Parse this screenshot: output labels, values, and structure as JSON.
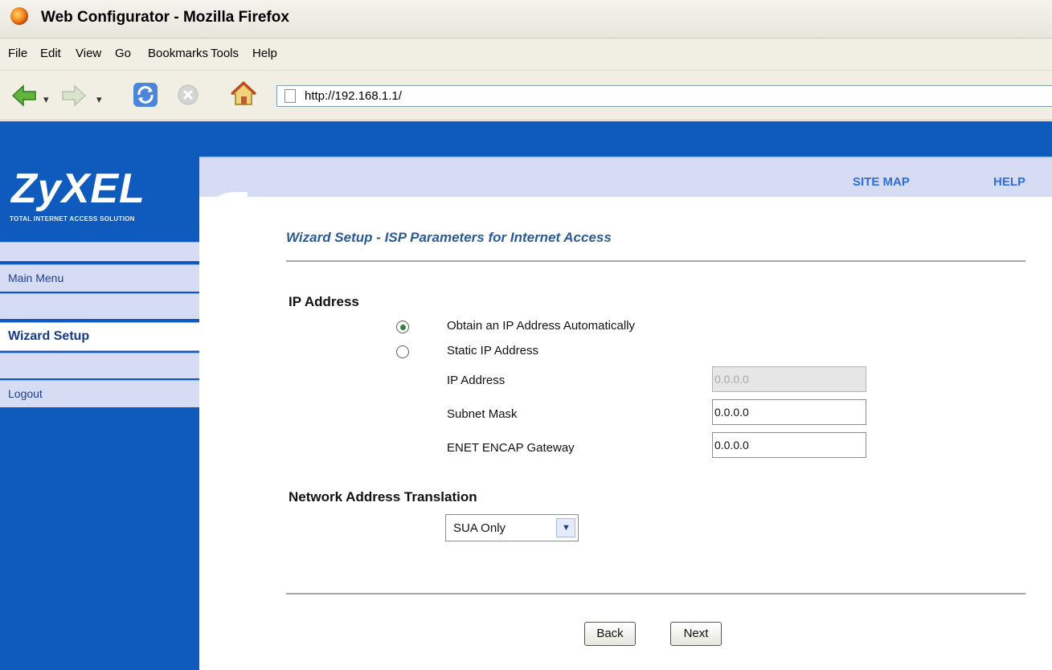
{
  "window": {
    "title": "Web Configurator - Mozilla Firefox"
  },
  "menu": [
    "File",
    "Edit",
    "View",
    "Go",
    "Bookmarks",
    "Tools",
    "Help"
  ],
  "toolbar": {
    "url": "http://192.168.1.1/",
    "dropdown_glyph": "▾"
  },
  "header": {
    "site_map": "SITE MAP",
    "help": "HELP"
  },
  "brand": {
    "logo": "ZyXEL",
    "tagline": "TOTAL INTERNET ACCESS SOLUTION"
  },
  "sidebar": {
    "items": [
      {
        "label": "Main Menu"
      },
      {
        "label": "Wizard Setup"
      },
      {
        "label": "Logout"
      }
    ]
  },
  "main": {
    "title": "Wizard Setup - ISP Parameters for Internet Access",
    "ip_section": {
      "heading": "IP Address",
      "auto_label": "Obtain an IP Address Automatically",
      "static_label": "Static IP Address",
      "selected": "auto",
      "fields": [
        {
          "label": "IP Address",
          "value": "0.0.0.0",
          "disabled": true
        },
        {
          "label": "Subnet Mask",
          "value": "0.0.0.0",
          "disabled": false
        },
        {
          "label": "ENET ENCAP Gateway",
          "value": "0.0.0.0",
          "disabled": false
        }
      ]
    },
    "nat_section": {
      "heading": "Network Address Translation",
      "selected": "SUA Only"
    },
    "buttons": {
      "back": "Back",
      "next": "Next"
    }
  }
}
